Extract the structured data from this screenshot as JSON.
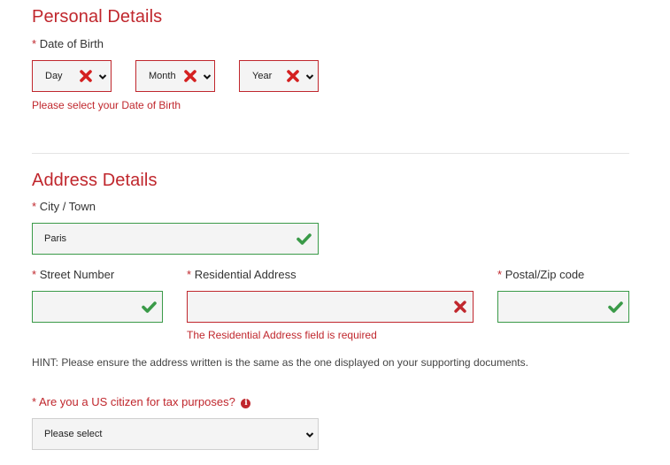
{
  "personal": {
    "title": "Personal Details",
    "dob_label": "Date of Birth",
    "required_mark": "*",
    "day": {
      "value": "Day",
      "status": "invalid"
    },
    "month": {
      "value": "Month",
      "status": "invalid"
    },
    "year": {
      "value": "Year",
      "status": "invalid"
    },
    "dob_error": "Please select your Date of Birth"
  },
  "address": {
    "title": "Address Details",
    "required_mark": "*",
    "city": {
      "label": "City / Town",
      "value": "Paris",
      "status": "valid"
    },
    "street_number": {
      "label": "Street Number",
      "value": "",
      "status": "valid"
    },
    "residential": {
      "label": "Residential Address",
      "value": "",
      "status": "invalid",
      "error": "The Residential Address field is required"
    },
    "postal": {
      "label": "Postal/Zip code",
      "value": "",
      "status": "valid"
    },
    "hint": "HINT: Please ensure the address written is the same as the one displayed on your supporting documents.",
    "us_citizen": {
      "label": "Are you a US citizen for tax purposes?",
      "info_icon": "i",
      "selected": "Please select"
    }
  },
  "colors": {
    "error": "#c0272d",
    "success": "#3a9a48",
    "field_bg": "#f4f4f4"
  }
}
